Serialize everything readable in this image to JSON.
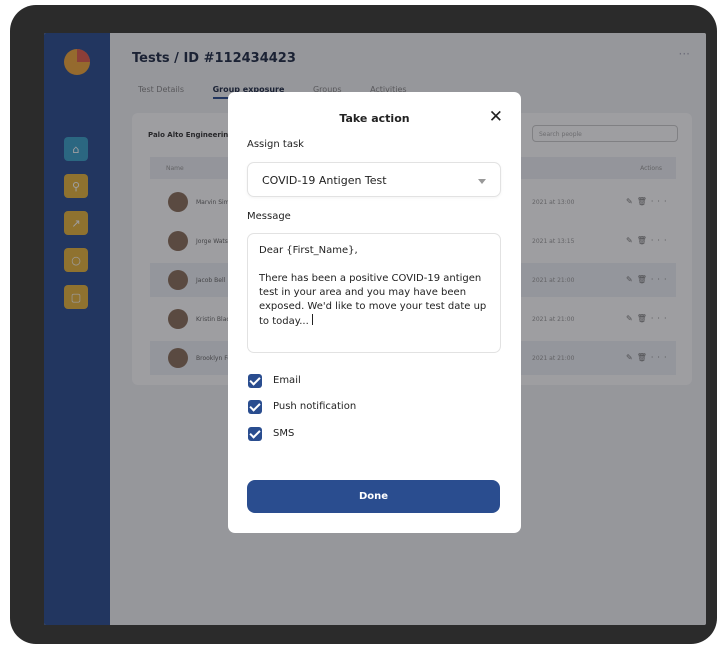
{
  "app": {
    "title": "Tests / ID #112434423",
    "more_icon": "ellipsis-icon",
    "logo_colors": [
      "#f0a53a",
      "#e05a4a"
    ]
  },
  "sidebar": {
    "items": [
      {
        "icon": "home-icon",
        "color": "#3aa0c9"
      },
      {
        "icon": "user-icon",
        "color": "#e6b43c"
      },
      {
        "icon": "trend-icon",
        "color": "#e6b43c"
      },
      {
        "icon": "search-icon",
        "color": "#e6b43c"
      },
      {
        "icon": "document-icon",
        "color": "#e6b43c"
      }
    ]
  },
  "tabs": [
    {
      "label": "Test Details",
      "active": false
    },
    {
      "label": "Group exposure",
      "active": true
    },
    {
      "label": "Groups",
      "active": false
    },
    {
      "label": "Activities",
      "active": false
    }
  ],
  "table": {
    "team": "Palo Alto Engineering Team",
    "search_placeholder": "Search people",
    "header_name": "Name",
    "header_actions": "Actions",
    "rows": [
      {
        "name": "Marvin Simmons",
        "date": "2021 at 13:00",
        "highlight": false
      },
      {
        "name": "Jorge Watson",
        "date": "2021 at 13:15",
        "highlight": false
      },
      {
        "name": "Jacob Bell",
        "date": "2021 at 21:00",
        "highlight": true
      },
      {
        "name": "Kristin Black",
        "date": "2021 at 21:00",
        "highlight": false
      },
      {
        "name": "Brooklyn Fox",
        "date": "2021 at 21:00",
        "highlight": true
      }
    ]
  },
  "modal": {
    "title": "Take action",
    "close_icon": "close-icon",
    "assign_label": "Assign task",
    "task_value": "COVID-19 Antigen Test",
    "message_label": "Message",
    "message_greeting": "Dear {First_Name},",
    "message_body": "There has been a positive COVID-19 antigen test in your area and you may have been exposed. We'd like to move your test date up to today...",
    "channels": [
      {
        "label": "Email",
        "checked": true
      },
      {
        "label": "Push notification",
        "checked": true
      },
      {
        "label": "SMS",
        "checked": true
      }
    ],
    "done_label": "Done",
    "accent": "#2a4d8f"
  }
}
